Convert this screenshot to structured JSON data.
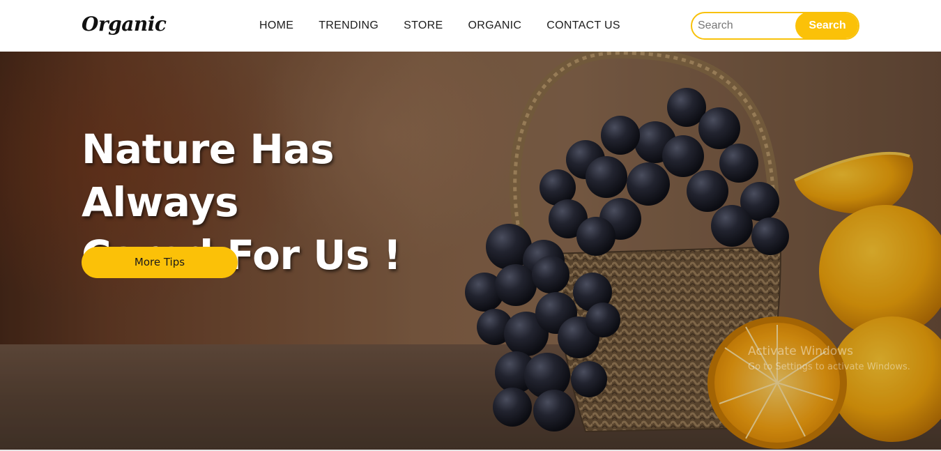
{
  "header": {
    "logo": "Organic",
    "nav": [
      {
        "label": "HOME"
      },
      {
        "label": "TRENDING"
      },
      {
        "label": "STORE"
      },
      {
        "label": "ORGANIC"
      },
      {
        "label": "CONTACT US"
      }
    ],
    "search": {
      "placeholder": "Search",
      "button_label": "Search"
    }
  },
  "hero": {
    "headline_line1": "Nature Has Always",
    "headline_line2": "Cared For Us !",
    "cta_label": "More Tips",
    "image": [
      "grapes",
      "basket",
      "oranges"
    ]
  },
  "watermark": {
    "title": "Activate Windows",
    "subtitle": "Go to Settings to activate Windows."
  },
  "colors": {
    "accent": "#fbc108",
    "nav_text": "#1c1c1c",
    "headline": "#ffffff"
  }
}
